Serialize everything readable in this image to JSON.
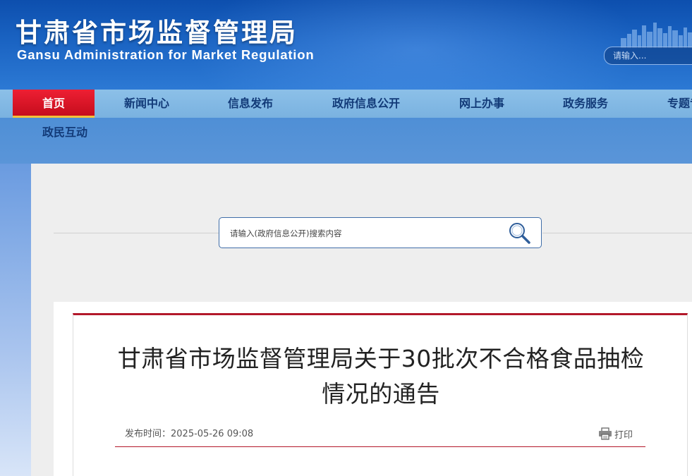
{
  "header": {
    "title_cn": "甘肃省市场监督管理局",
    "title_en": "Gansu Administration for Market Regulation",
    "search_placeholder": "请输入..."
  },
  "nav": {
    "items": [
      {
        "label": "首页",
        "active": true
      },
      {
        "label": "新闻中心"
      },
      {
        "label": "信息发布"
      },
      {
        "label": "政府信息公开"
      },
      {
        "label": "网上办事"
      },
      {
        "label": "政务服务"
      },
      {
        "label": "专题专栏"
      }
    ],
    "row2": {
      "label": "政民互动"
    }
  },
  "gov_search": {
    "placeholder": "请输入(政府信息公开)搜索内容",
    "icon": "magnifier-icon"
  },
  "article": {
    "title": "甘肃省市场监督管理局关于30批次不合格食品抽检情况的通告",
    "publish_label": "发布时间：",
    "publish_time": "2025-05-26 09:08",
    "print_label": "打印",
    "print_icon": "printer-icon"
  },
  "colors": {
    "header_blue": "#0d4fae",
    "nav_light": "#8cc0e8",
    "nav_active_red": "#d81528",
    "accent_red": "#b3182a"
  }
}
